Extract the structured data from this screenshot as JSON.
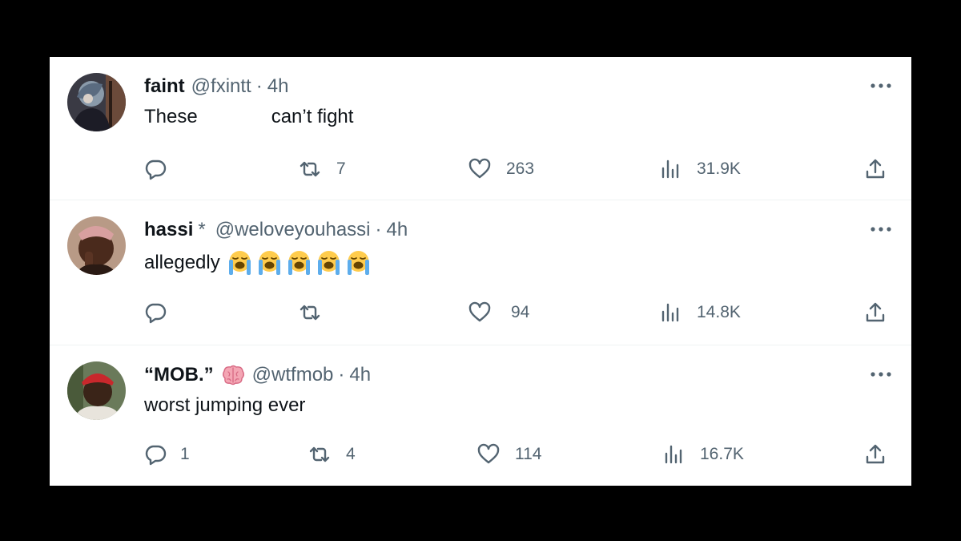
{
  "tweets": [
    {
      "name": "faint",
      "handle": "@fxintt",
      "separator": "·",
      "time": "4h",
      "text_before": "These",
      "text_after": "can’t fight",
      "reply_count": "",
      "retweet_count": "7",
      "like_count": "263",
      "view_count": "31.9K",
      "avatar_icon": "avatar-anime-character"
    },
    {
      "name": "hassi",
      "badge": "*",
      "handle": "@weloveyouhassi",
      "separator": "·",
      "time": "4h",
      "text": "allegedly",
      "emoji_icon": "loudly-crying-face-emoji",
      "emoji_count": 5,
      "reply_count": "",
      "retweet_count": "",
      "like_count": "94",
      "view_count": "14.8K",
      "avatar_icon": "avatar-person"
    },
    {
      "name": "“MOB.”",
      "name_emoji": "brain-emoji",
      "handle": "@wtfmob",
      "separator": "·",
      "time": "4h",
      "text": "worst jumping ever",
      "reply_count": "1",
      "retweet_count": "4",
      "like_count": "114",
      "view_count": "16.7K",
      "avatar_icon": "avatar-person-red-cap"
    }
  ],
  "colors": {
    "text_primary": "#0f1419",
    "text_secondary": "#536471",
    "divider": "#eff3f4",
    "background_outer": "#000000"
  }
}
